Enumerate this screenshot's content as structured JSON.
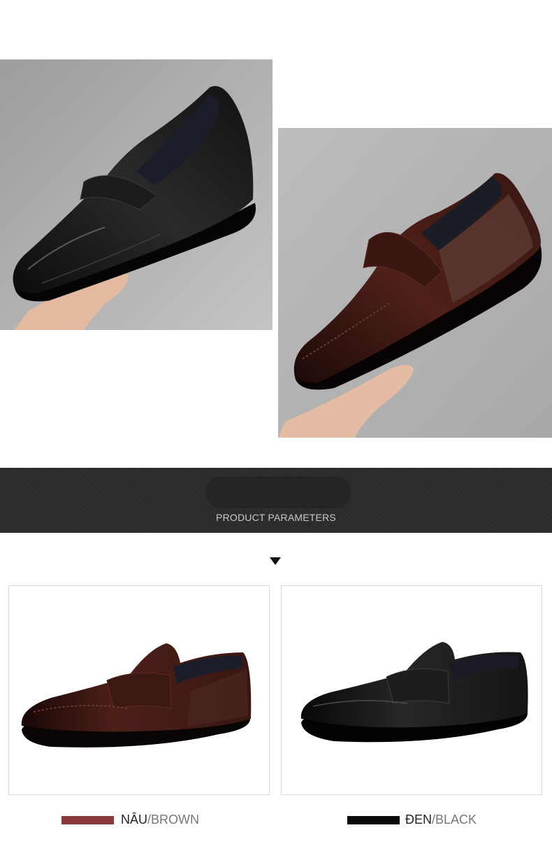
{
  "banner": {
    "title": "PRODUCT PARAMETERS"
  },
  "variants": [
    {
      "vietnamese": "NÂU",
      "english": "/BROWN",
      "swatch_color": "#8b3a3a"
    },
    {
      "vietnamese": "ĐEN",
      "english": "/BLACK",
      "swatch_color": "#0a0a0a"
    }
  ],
  "colors": {
    "banner_bg": "#2c2c2c",
    "banner_text": "#c9c9c9",
    "brown_leather": "#4a1f1a",
    "black_leather": "#141414"
  }
}
